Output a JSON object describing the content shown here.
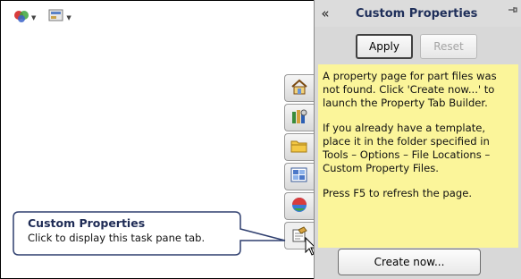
{
  "toolbar": {
    "items": [
      {
        "icon": "appearance-icon"
      },
      {
        "icon": "display-settings-icon"
      }
    ]
  },
  "task_tabs": [
    {
      "icon": "home-icon"
    },
    {
      "icon": "design-library-icon"
    },
    {
      "icon": "file-explorer-icon"
    },
    {
      "icon": "view-palette-icon"
    },
    {
      "icon": "appearances-scenes-icon"
    },
    {
      "icon": "custom-properties-icon"
    }
  ],
  "pane": {
    "collapse_glyph": "«",
    "title": "Custom Properties",
    "apply_label": "Apply",
    "reset_label": "Reset",
    "message": [
      "A property page for part files was not found. Click 'Create now...' to launch the Property Tab Builder.",
      "If you already have a template, place it in the folder specified in Tools – Options – File Locations – Custom Property Files.",
      "Press F5 to refresh the page."
    ],
    "create_label": "Create now..."
  },
  "tooltip": {
    "title": "Custom Properties",
    "body": "Click to display this task pane tab."
  },
  "colors": {
    "note_bg": "#fbf59a",
    "title_color": "#1f2f5a"
  }
}
